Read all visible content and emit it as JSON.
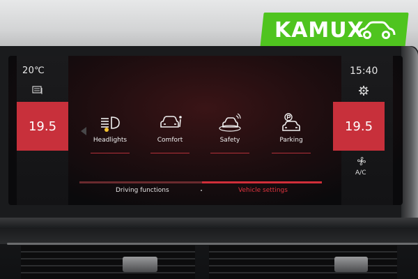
{
  "logo": {
    "text": "KAMUX",
    "color": "#4fc41f",
    "icon": "car-outline-icon"
  },
  "status": {
    "outside_temp": "20℃",
    "clock": "15:40"
  },
  "climate": {
    "left_temp": "19.5",
    "right_temp": "19.5",
    "ac_label": "A/C",
    "temp_box_color": "#c8303b"
  },
  "menu": {
    "items": [
      {
        "label": "Headlights",
        "icon": "headlights-icon"
      },
      {
        "label": "Comfort",
        "icon": "comfort-icon"
      },
      {
        "label": "Safety",
        "icon": "safety-icon"
      },
      {
        "label": "Parking",
        "icon": "parking-icon"
      }
    ]
  },
  "tabs": [
    {
      "label": "Driving functions",
      "active": false
    },
    {
      "label": "Vehicle settings",
      "active": true
    }
  ],
  "colors": {
    "accent": "#c8303b",
    "active_tab_text": "#e0343f"
  }
}
